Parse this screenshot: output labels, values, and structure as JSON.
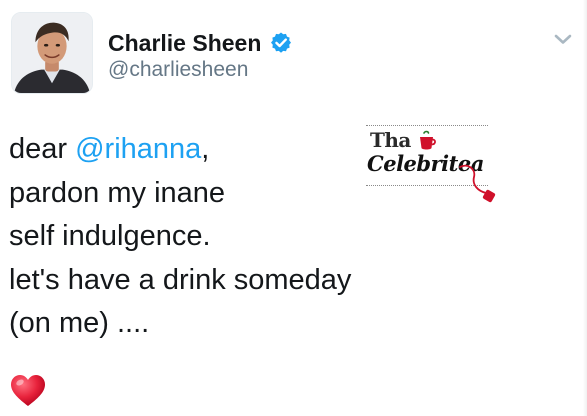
{
  "tweet": {
    "author": {
      "display_name": "Charlie Sheen",
      "username": "@charliesheen",
      "verified": true,
      "avatar_icon": "profile-photo"
    },
    "text_lines": [
      {
        "prefix": "dear ",
        "mention": "@rihanna",
        "suffix": ","
      },
      {
        "text": "pardon my inane"
      },
      {
        "text": "self indulgence."
      },
      {
        "text": "let's have a drink someday"
      },
      {
        "text": "(on me) ...."
      }
    ],
    "emoji": "heart-emoji",
    "menu_icon": "chevron-down-icon"
  },
  "watermark": {
    "line1": "Tha",
    "line2": "Celebritea",
    "icon": "teacup-icon"
  },
  "colors": {
    "text": "#14171a",
    "secondary": "#657786",
    "link": "#1da1f2",
    "verified": "#1da1f2",
    "heart": "#e0245e",
    "watermark_red": "#d0112b"
  }
}
